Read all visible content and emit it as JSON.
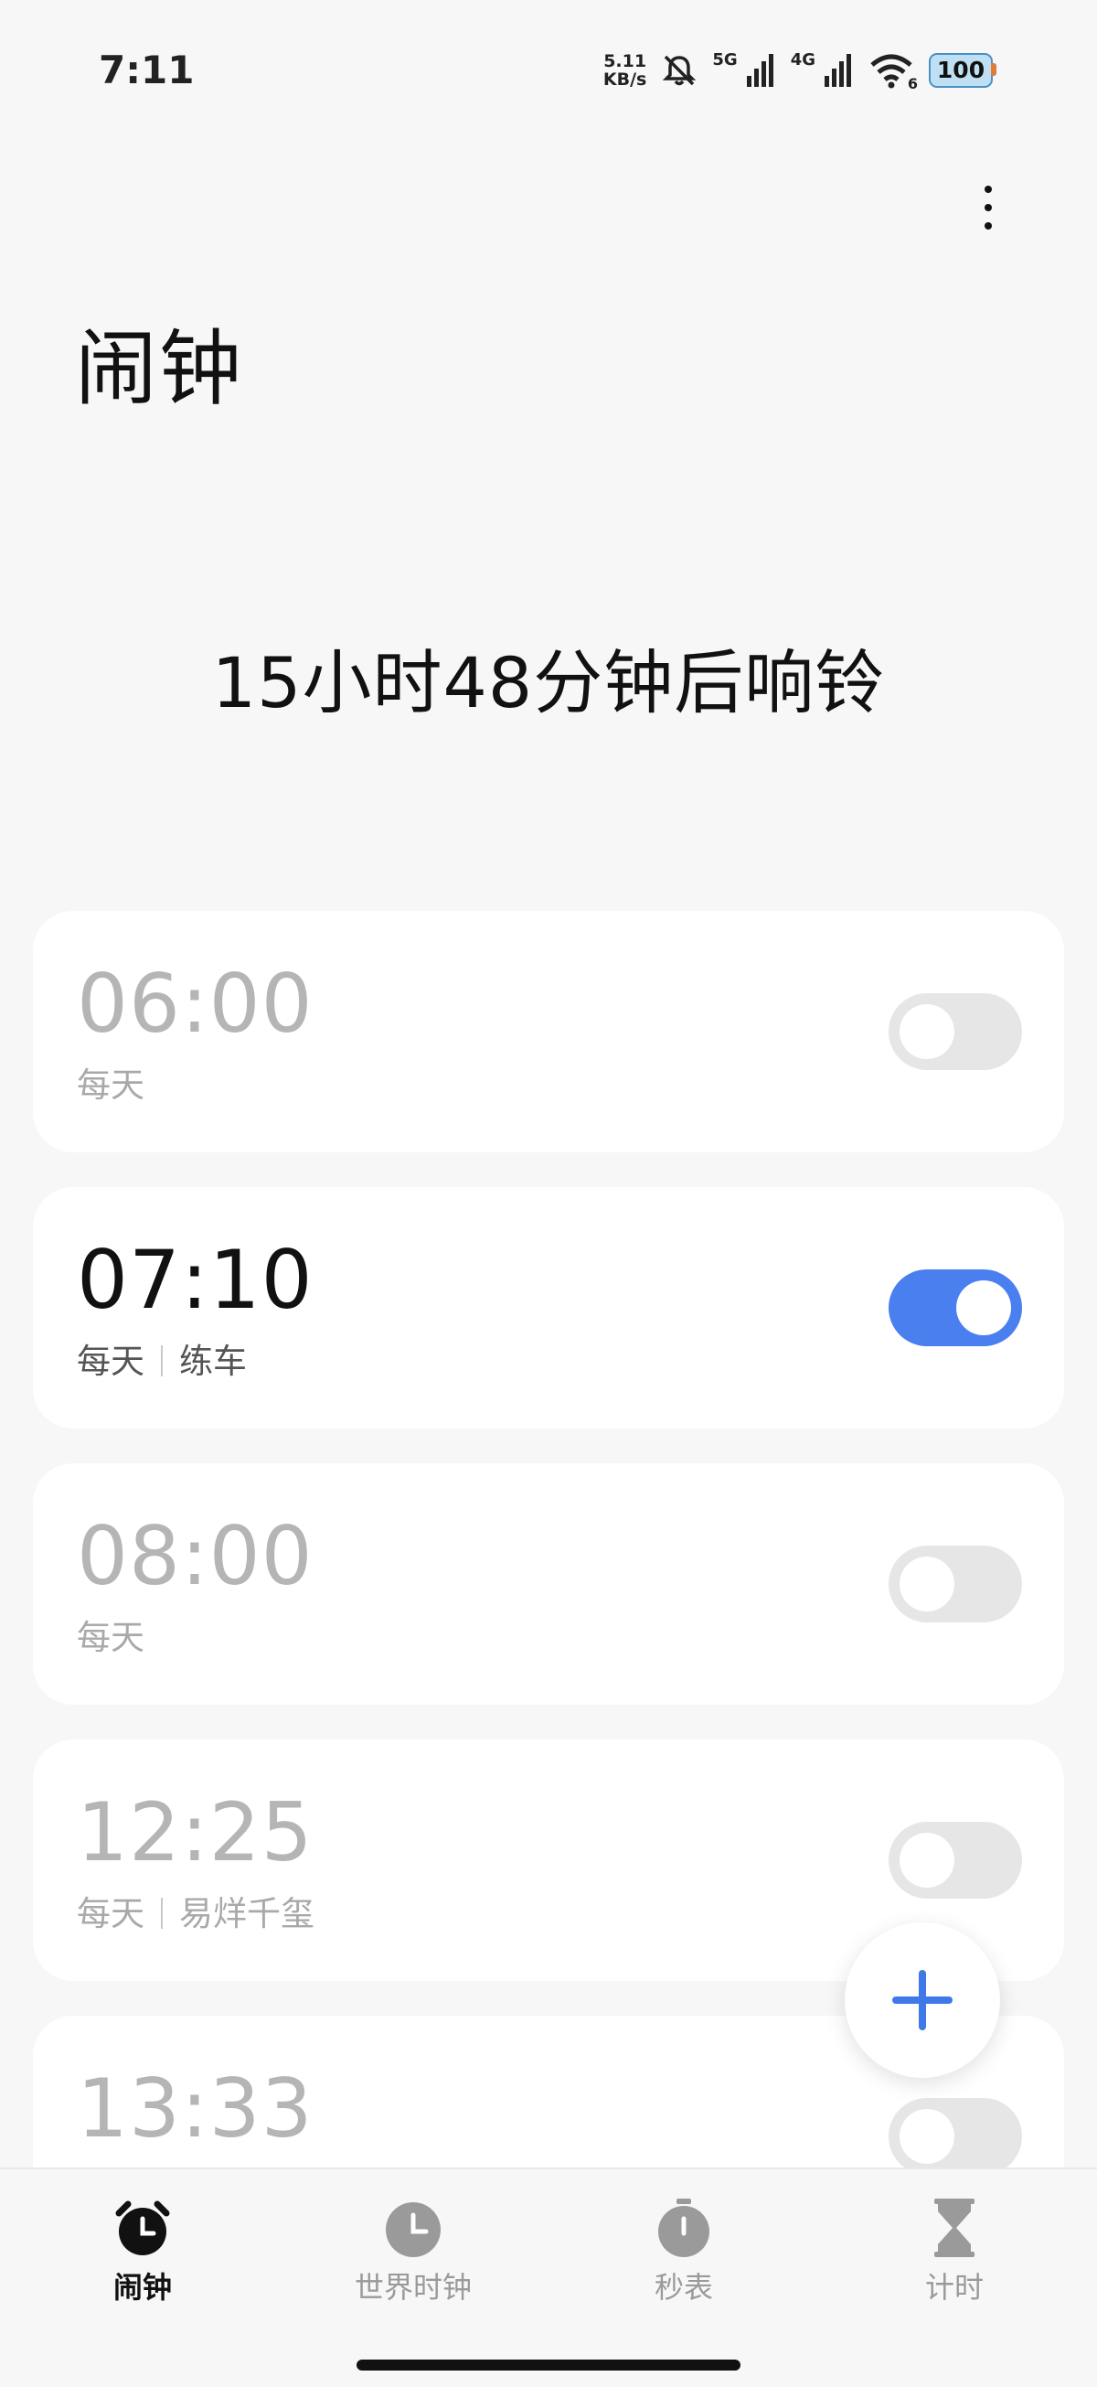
{
  "status_bar": {
    "time": "7:11",
    "net_speed_value": "5.11",
    "net_speed_unit": "KB/s",
    "sim1_label": "5G",
    "sim2_label": "4G",
    "wifi_label": "6",
    "battery": "100"
  },
  "header": {
    "title": "闹钟"
  },
  "next_alarm_text": "15小时48分钟后响铃",
  "alarms": [
    {
      "time": "06:00",
      "repeat": "每天",
      "label": "",
      "enabled": false
    },
    {
      "time": "07:10",
      "repeat": "每天",
      "label": "练车",
      "enabled": true
    },
    {
      "time": "08:00",
      "repeat": "每天",
      "label": "",
      "enabled": false
    },
    {
      "time": "12:25",
      "repeat": "每天",
      "label": "易烊千玺",
      "enabled": false
    },
    {
      "time": "13:33",
      "repeat": "",
      "label": "",
      "enabled": false
    }
  ],
  "bottom_nav": [
    {
      "label": "闹钟",
      "icon": "alarm-clock-icon",
      "active": true
    },
    {
      "label": "世界时钟",
      "icon": "world-clock-icon",
      "active": false
    },
    {
      "label": "秒表",
      "icon": "stopwatch-icon",
      "active": false
    },
    {
      "label": "计时",
      "icon": "hourglass-icon",
      "active": false
    }
  ],
  "colors": {
    "accent": "#4a7ff0",
    "background": "#f7f7f7",
    "card": "#ffffff",
    "inactive_text": "#b5b5b5"
  }
}
